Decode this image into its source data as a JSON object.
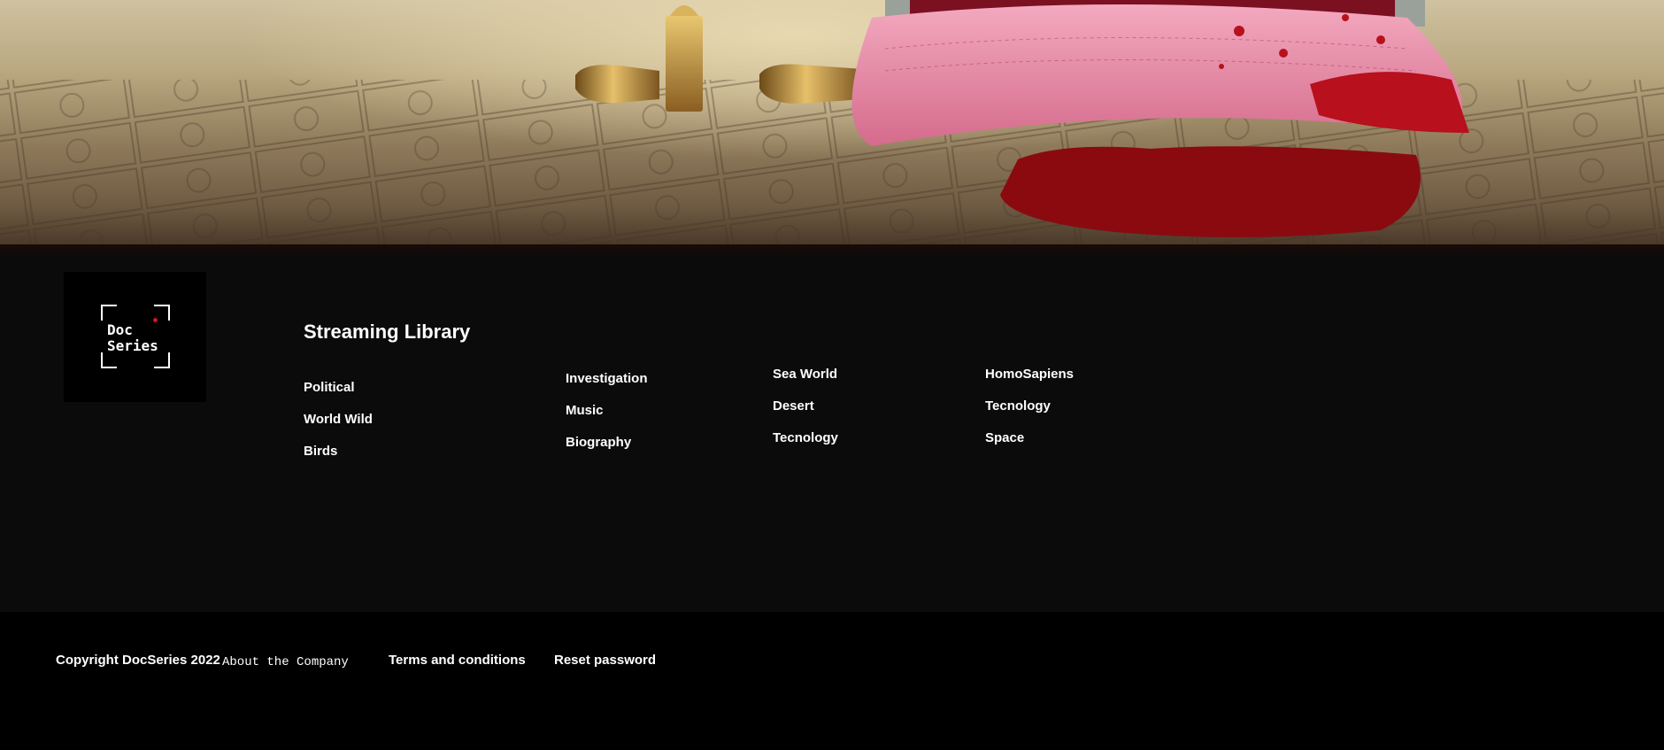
{
  "footer": {
    "logo": {
      "line1": "Doc",
      "line2": "Series",
      "accent": "#d4141c"
    },
    "section_title": "Streaming Library",
    "columns": [
      [
        "Political",
        "World Wild",
        "Birds"
      ],
      [
        "Investigation",
        "Music",
        "Biography"
      ],
      [
        "Sea World",
        "Desert",
        "Tecnology"
      ],
      [
        "HomoSapiens",
        "Tecnology",
        "Space"
      ]
    ]
  },
  "bottom_bar": {
    "copyright": "Copyright DocSeries 2022",
    "about": "About the Company",
    "terms": "Terms and conditions",
    "reset": "Reset password"
  }
}
